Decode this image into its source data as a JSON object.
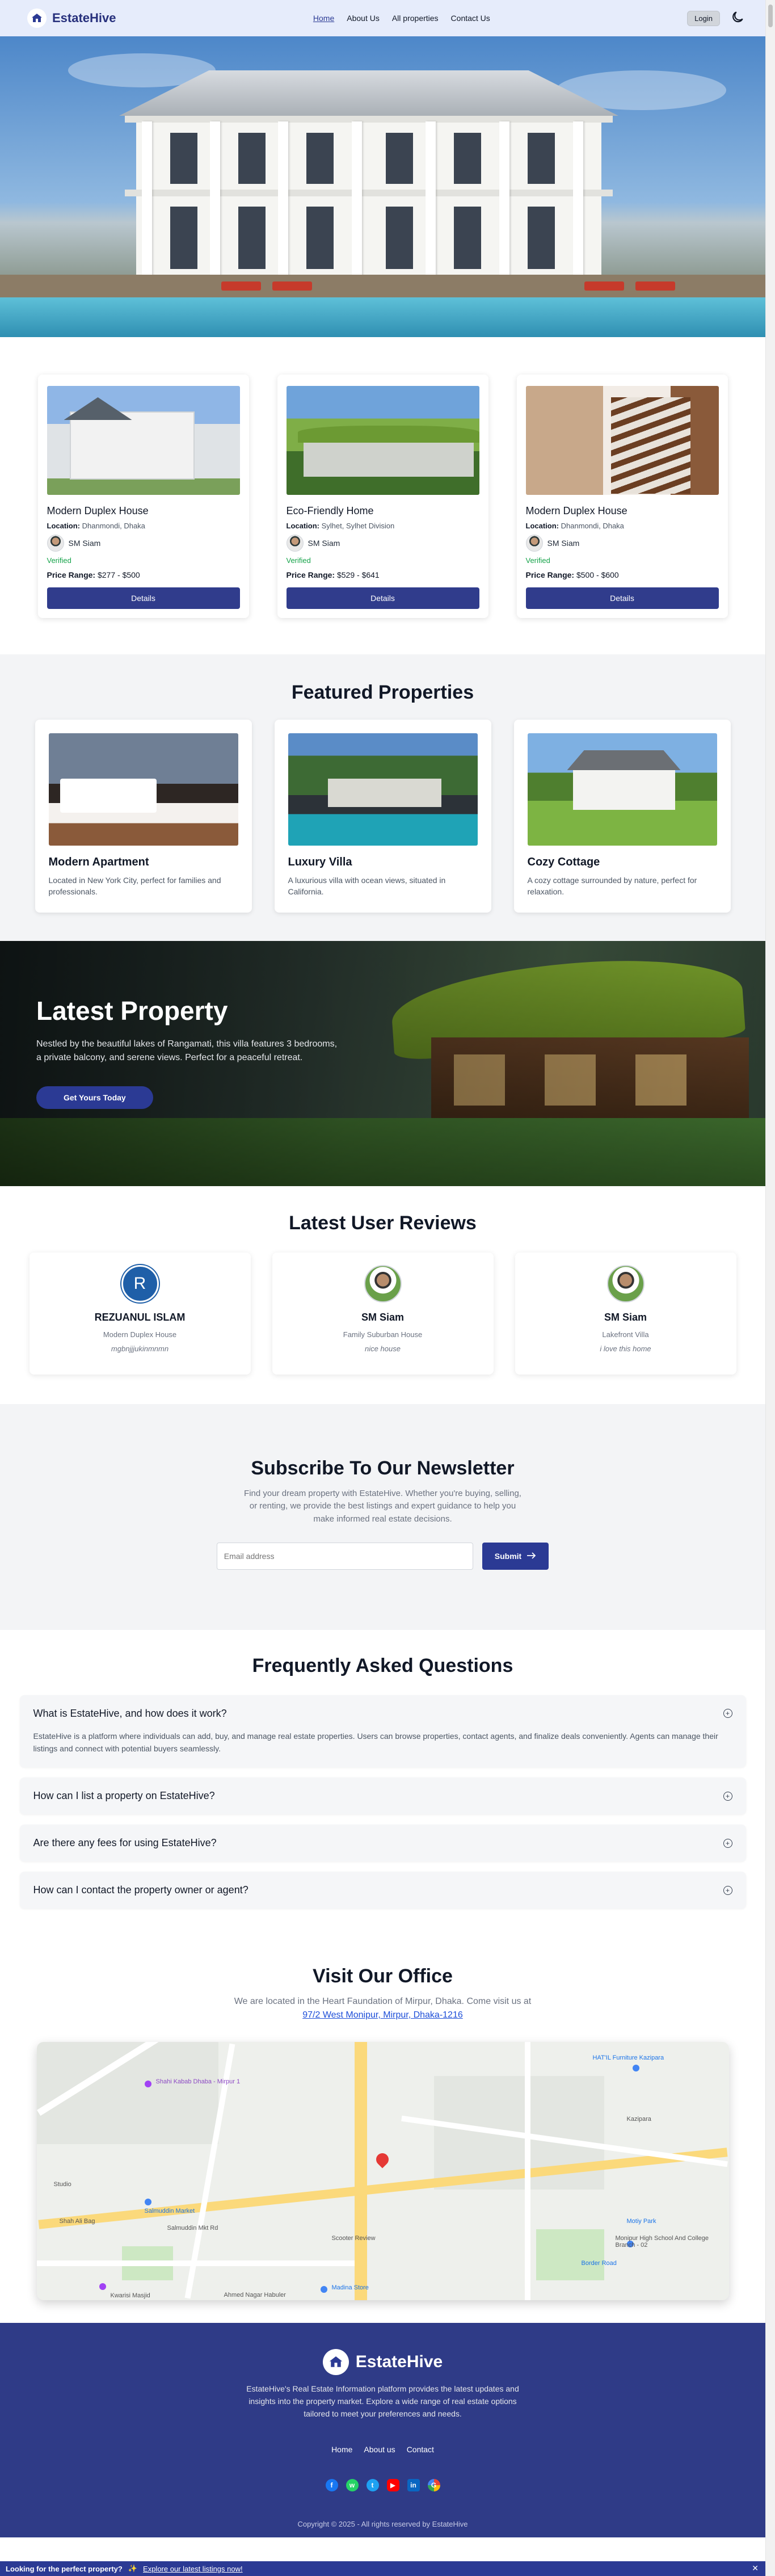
{
  "nav": {
    "brand": "EstateHive",
    "links": [
      "Home",
      "About Us",
      "All properties",
      "Contact Us"
    ],
    "login": "Login",
    "theme_icon": "moon-icon"
  },
  "properties": [
    {
      "title": "Modern Duplex House",
      "location_label": "Location:",
      "location": "Dhanmondi, Dhaka",
      "agent": "SM Siam",
      "status": "Verified",
      "price_label": "Price Range:",
      "price": "$277 - $500",
      "button": "Details"
    },
    {
      "title": "Eco-Friendly Home",
      "location_label": "Location:",
      "location": "Sylhet, Sylhet Division",
      "agent": "SM Siam",
      "status": "Verified",
      "price_label": "Price Range:",
      "price": "$529 - $641",
      "button": "Details"
    },
    {
      "title": "Modern Duplex House",
      "location_label": "Location:",
      "location": "Dhanmondi, Dhaka",
      "agent": "SM Siam",
      "status": "Verified",
      "price_label": "Price Range:",
      "price": "$500 - $600",
      "button": "Details"
    }
  ],
  "featured": {
    "title": "Featured Properties",
    "items": [
      {
        "name": "Modern Apartment",
        "desc": "Located in New York City, perfect for families and professionals."
      },
      {
        "name": "Luxury Villa",
        "desc": "A luxurious villa with ocean views, situated in California."
      },
      {
        "name": "Cozy Cottage",
        "desc": "A cozy cottage surrounded by nature, perfect for relaxation."
      }
    ]
  },
  "latest": {
    "title": "Latest Property",
    "text": "Nestled by the beautiful lakes of Rangamati, this villa features 3 bedrooms, a private balcony, and serene views. Perfect for a peaceful retreat.",
    "cta": "Get Yours Today"
  },
  "reviews": {
    "title": "Latest User Reviews",
    "items": [
      {
        "initial": "R",
        "name": "REZUANUL ISLAM",
        "property": "Modern Duplex House",
        "text": "mgbnjjjukinmnmn"
      },
      {
        "initial": "",
        "name": "SM Siam",
        "property": "Family Suburban House",
        "text": "nice house"
      },
      {
        "initial": "",
        "name": "SM Siam",
        "property": "Lakefront Villa",
        "text": "i love this home"
      }
    ]
  },
  "newsletter": {
    "title": "Subscribe To Our Newsletter",
    "text": "Find your dream property with EstateHive. Whether you're buying, selling, or renting, we provide the best listings and expert guidance to help you make informed real estate decisions.",
    "placeholder": "Email address",
    "button": "Submit",
    "button_icon": "arrow-right-icon"
  },
  "faq": {
    "title": "Frequently Asked Questions",
    "items": [
      {
        "q": "What is EstateHive, and how does it work?",
        "a": "EstateHive is a platform where individuals can add, buy, and manage real estate properties. Users can browse properties, contact agents, and finalize deals conveniently. Agents can manage their listings and connect with potential buyers seamlessly."
      },
      {
        "q": "How can I list a property on EstateHive?",
        "a": ""
      },
      {
        "q": "Are there any fees for using EstateHive?",
        "a": ""
      },
      {
        "q": "How can I contact the property owner or agent?",
        "a": ""
      }
    ]
  },
  "visit": {
    "title": "Visit Our Office",
    "text": "We are located in the Heart Faundation of Mirpur, Dhaka. Come visit us at",
    "address": "97/2 West Monipur, Mirpur, Dhaka-1216"
  },
  "map_labels": {
    "a": "Shahi Kabab Dhaba - Mirpur 1",
    "b": "Salmuddin Market",
    "c": "Salmuddin Mkt Rd",
    "d": "Ahmed Nagar Habuler",
    "e": "Kwarisi Masjid",
    "f": "Madina Store",
    "g": "Scooter Review",
    "h": "Border Road",
    "i": "Monipur High School And College Branch - 02",
    "j": "Motiy Park",
    "k": "Kazipara",
    "l": "HAT'IL Furniture Kazipara",
    "m": "Studio",
    "n": "Shah Ali Bag"
  },
  "footer": {
    "brand": "EstateHive",
    "about": "EstateHive's Real Estate Information platform provides the latest updates and insights into the property market. Explore a wide range of real estate options tailored to meet your preferences and needs.",
    "links": [
      "Home",
      "About us",
      "Contact"
    ],
    "copyright": "Copyright © 2025 - All rights reserved by EstateHive"
  },
  "promo": {
    "lead": "Looking for the perfect property?",
    "link": "Explore our latest listings now!",
    "close": "✕"
  },
  "colors": {
    "primary": "#2b3a94",
    "nav_bg": "#e6ecfb",
    "verified": "#16a34a",
    "footer_bg": "#2f3b87"
  }
}
